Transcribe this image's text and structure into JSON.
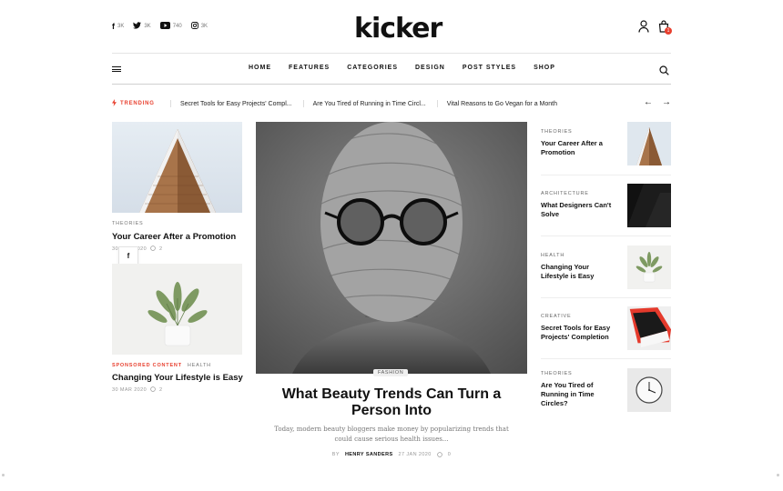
{
  "header": {
    "logo": "kicker",
    "socials": [
      {
        "icon": "facebook-icon",
        "glyph": "f",
        "count": "3K"
      },
      {
        "icon": "twitter-icon",
        "glyph": "t",
        "count": "3K"
      },
      {
        "icon": "youtube-icon",
        "glyph": "▶",
        "count": "740"
      },
      {
        "icon": "instagram-icon",
        "glyph": "◎",
        "count": "3K"
      }
    ],
    "cart_count": "1"
  },
  "nav": {
    "items": [
      "HOME",
      "FEATURES",
      "CATEGORIES",
      "DESIGN",
      "POST STYLES",
      "SHOP"
    ]
  },
  "trending": {
    "label": "TRENDING",
    "items": [
      "Secret Tools for Easy Projects' Compl...",
      "Are You Tired of Running in Time Circl...",
      "Vital Reasons to Go Vegan for a Month"
    ],
    "prev": "←",
    "next": "→"
  },
  "left_posts": [
    {
      "category": "THEORIES",
      "title": "Your Career After a Promotion",
      "date": "30 MAR 2020",
      "comments": "2"
    },
    {
      "sponsored": "SPONSORED CONTENT",
      "category": "HEALTH",
      "title": "Changing Your Lifestyle is Easy",
      "date": "30 MAR 2020",
      "comments": "2"
    }
  ],
  "share": {
    "glyph": "f"
  },
  "featured": {
    "tag": "FASHION",
    "title": "What Beauty Trends Can Turn a Person Into",
    "excerpt": "Today, modern beauty bloggers make money by popularizing trends that could cause serious health issues...",
    "by": "BY",
    "author": "HENRY SANDERS",
    "date": "27 JAN 2020",
    "comments": "0"
  },
  "side_posts": [
    {
      "category": "THEORIES",
      "title": "Your Career After a Promotion"
    },
    {
      "category": "ARCHITECTURE",
      "title": "What Designers Can't Solve"
    },
    {
      "category": "HEALTH",
      "title": "Changing Your Lifestyle is Easy"
    },
    {
      "category": "CREATIVE",
      "title": "Secret Tools for Easy Projects' Completion"
    },
    {
      "category": "THEORIES",
      "title": "Are You Tired of Running in Time Circles?"
    }
  ],
  "colors": {
    "accent": "#e8402f",
    "text": "#111111",
    "muted": "#777777"
  }
}
